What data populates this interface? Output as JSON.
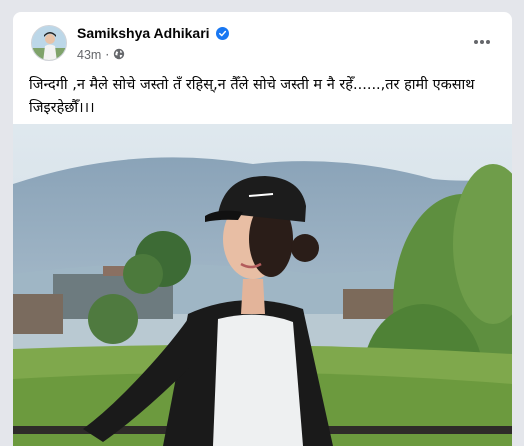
{
  "post": {
    "author": "Samikshya Adhikari",
    "time": "43m",
    "separator": "·",
    "audience_icon": "globe-icon",
    "verified_icon": "verified-badge-icon",
    "more_icon": "more-options-icon",
    "text_line1": "जिन्दगी ,न मैले सोचे जस्तो तँ रहिस्,न तैँले सोचे जस्ती  म नै रहेँ......,तर हामी एकसाथ",
    "text_line2": "जिइरहेछौँ।।।"
  },
  "colors": {
    "accent": "#1877f2",
    "page_bg": "#e4e6eb",
    "secondary_text": "#65676b"
  }
}
